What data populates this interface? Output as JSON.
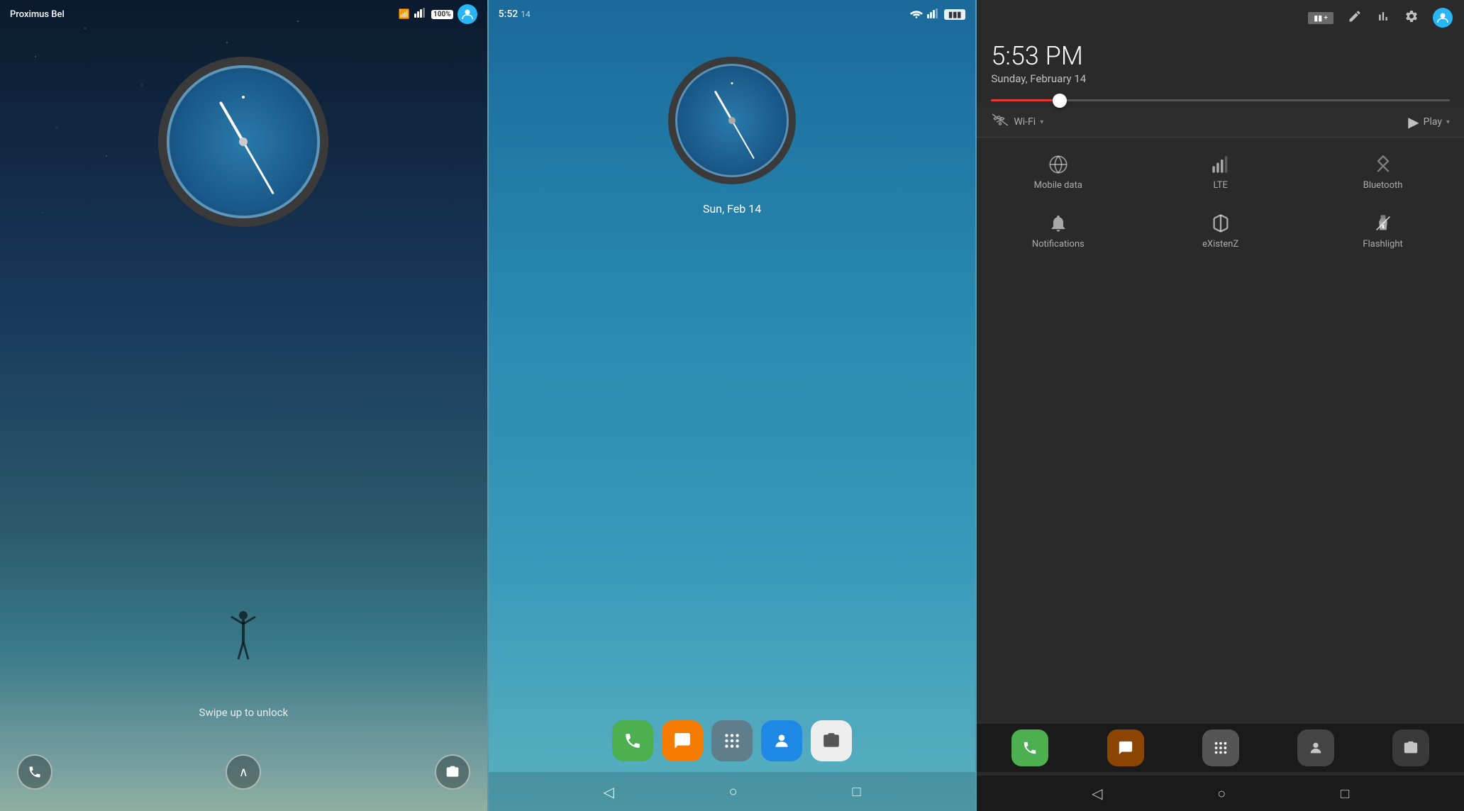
{
  "panels": {
    "lockscreen": {
      "carrier": "Proximus Bel",
      "battery": "100",
      "swipe_text": "Swipe up to unlock",
      "clock": {
        "hour_rotate": "-30deg",
        "minute_rotate": "150deg"
      }
    },
    "homescreen": {
      "time": "5:52",
      "time_suffix": "14",
      "date": "Sun, Feb 14",
      "apps": [
        {
          "name": "phone",
          "emoji": "📞",
          "color": "#4caf50"
        },
        {
          "name": "chat",
          "emoji": "💬",
          "color": "#f57c00"
        },
        {
          "name": "grid",
          "emoji": "⋯",
          "color": "#607d8b"
        },
        {
          "name": "contacts",
          "emoji": "👤",
          "color": "#1e88e5"
        },
        {
          "name": "camera",
          "emoji": "📷",
          "color": "#eeeeee"
        }
      ]
    },
    "notification": {
      "time": "5:53 PM",
      "date": "Sunday, February 14",
      "quick_items": [
        {
          "icon": "📶",
          "label": "Wi-Fi",
          "has_dropdown": true
        },
        {
          "icon": "▶",
          "label": "Play",
          "has_dropdown": true
        }
      ],
      "grid_items": [
        {
          "label": "Mobile data"
        },
        {
          "label": "LTE"
        },
        {
          "label": "Bluetooth"
        },
        {
          "label": "Notifications"
        },
        {
          "label": "eXistenZ"
        },
        {
          "label": "Flashlight"
        }
      ],
      "bottom_apps": [
        {
          "color": "#4caf50"
        },
        {
          "color": "#8b4a00"
        },
        {
          "color": "#607d8b"
        },
        {
          "color": "#555"
        },
        {
          "color": "#444"
        }
      ]
    }
  }
}
